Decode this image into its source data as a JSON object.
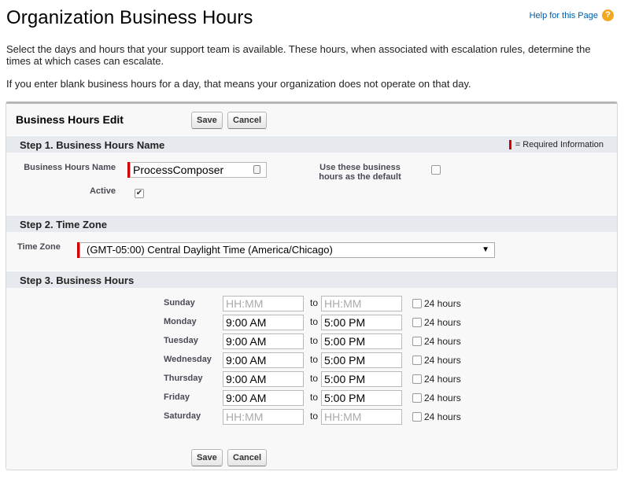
{
  "header": {
    "title": "Organization Business Hours",
    "help_link": "Help for this Page",
    "help_icon": "question-circle-icon",
    "help_icon_glyph": "?"
  },
  "intro": {
    "paragraph1": "Select the days and hours that your support team is available. These hours, when associated with escalation rules, determine the times at which cases can escalate.",
    "paragraph2": "If you enter blank business hours for a day, that means your organization does not operate on that day."
  },
  "edit": {
    "title": "Business Hours Edit",
    "save_label": "Save",
    "cancel_label": "Cancel",
    "required_legend": "= Required Information"
  },
  "step1": {
    "title": "Step 1. Business Hours Name",
    "name_label": "Business Hours Name",
    "name_value": "ProcessComposer",
    "default_label": "Use these business hours as the default",
    "default_checked": false,
    "active_label": "Active",
    "active_checked": true,
    "checkmark_glyph": "✔"
  },
  "step2": {
    "title": "Step 2. Time Zone",
    "tz_label": "Time Zone",
    "tz_value": "(GMT-05:00) Central Daylight Time (America/Chicago)",
    "caret_glyph": "▼"
  },
  "step3": {
    "title": "Step 3. Business Hours",
    "to_label": "to",
    "hours24_label": "24 hours",
    "placeholder": "HH:MM",
    "days": [
      {
        "name": "Sunday",
        "start": "",
        "end": "",
        "all_day": false
      },
      {
        "name": "Monday",
        "start": "9:00 AM",
        "end": "5:00 PM",
        "all_day": false
      },
      {
        "name": "Tuesday",
        "start": "9:00 AM",
        "end": "5:00 PM",
        "all_day": false
      },
      {
        "name": "Wednesday",
        "start": "9:00 AM",
        "end": "5:00 PM",
        "all_day": false
      },
      {
        "name": "Thursday",
        "start": "9:00 AM",
        "end": "5:00 PM",
        "all_day": false
      },
      {
        "name": "Friday",
        "start": "9:00 AM",
        "end": "5:00 PM",
        "all_day": false
      },
      {
        "name": "Saturday",
        "start": "",
        "end": "",
        "all_day": false
      }
    ]
  },
  "colors": {
    "section_bar": "#e6eaef",
    "required": "#cc0000",
    "link": "#015ba7",
    "help_icon": "#f4a81d"
  }
}
